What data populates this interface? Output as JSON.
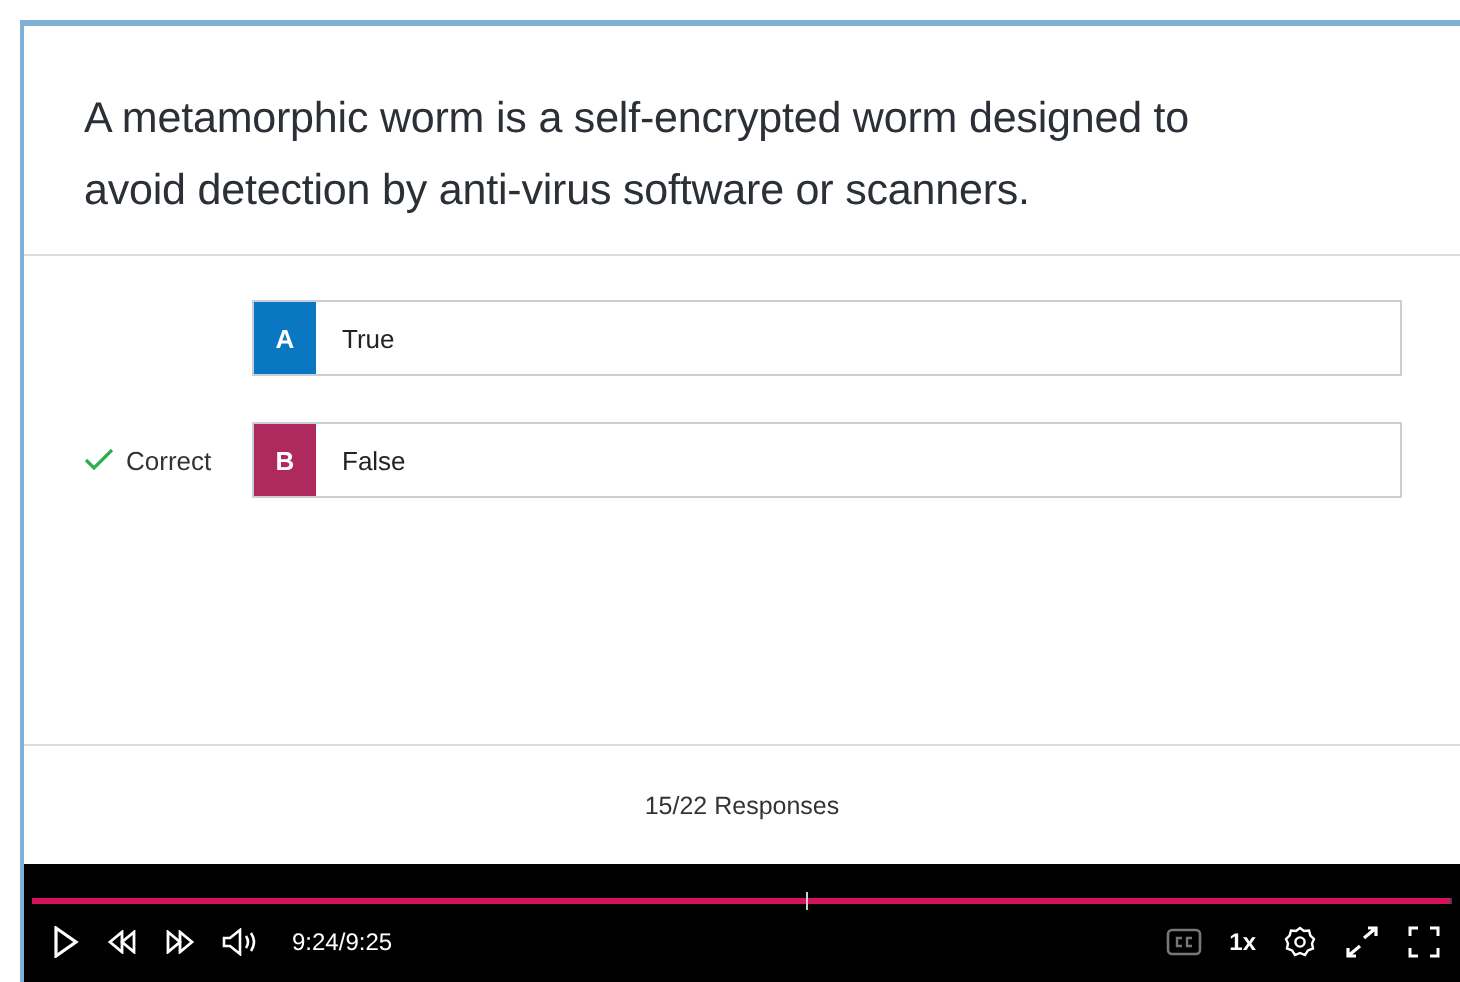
{
  "question": "A metamorphic worm is a self-encrypted worm designed to avoid detection by anti-virus software or scanners.",
  "correct_label": "Correct",
  "options": [
    {
      "letter": "A",
      "text": "True",
      "color": "#0a77c2",
      "correct": false
    },
    {
      "letter": "B",
      "text": "False",
      "color": "#ae2a5e",
      "correct": true
    }
  ],
  "responses": "15/22 Responses",
  "player": {
    "level": 0.998,
    "time": "9:24/9:25",
    "speed": "1x"
  }
}
